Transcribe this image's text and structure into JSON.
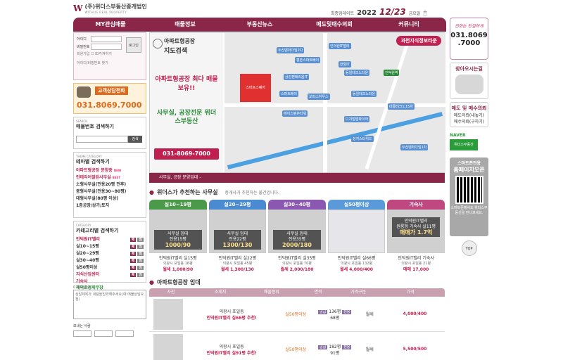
{
  "header": {
    "logo_mark": "W",
    "logo_name": "(주)위더스부동산중개법인",
    "logo_sub": "WITHUS REAL PROPERTY",
    "update_label": "최종업데이트",
    "update_year": "2022",
    "update_date": "12/23",
    "update_day": "금요일"
  },
  "nav": [
    {
      "label": "MY관심매물"
    },
    {
      "label": "매물정보"
    },
    {
      "label": "부동산뉴스"
    },
    {
      "label": "매도및매수의뢰"
    },
    {
      "label": "커뮤니티"
    }
  ],
  "login": {
    "id_label": "아이디",
    "pw_label": "비밀번호",
    "button": "로그인",
    "signup": "회원가입",
    "save_id": "ID가져하기",
    "find": "아이디/비밀번호 찾기"
  },
  "call": {
    "badge": "고객상담전화",
    "number": "031.8069.7000"
  },
  "search": {
    "hd": "SEARCH",
    "title": "매물번호 검색하기",
    "button": "검색"
  },
  "theme": {
    "hd": "THEME CATEGORY",
    "title": "테마별 검색하기",
    "items": [
      {
        "label": "아파트형공장 분양중",
        "hl": true,
        "new": "NEW"
      },
      {
        "label": "인테리어잘된사무실",
        "hl": true,
        "new": "BEST"
      },
      {
        "label": "소형사무실(전용20평 전후)",
        "hl": false,
        "new": ""
      },
      {
        "label": "중형사무실(전용30~80평)",
        "hl": false,
        "new": ""
      },
      {
        "label": "대형사무실(80평 이상)",
        "hl": false,
        "new": ""
      },
      {
        "label": "1층공장/상가/토지",
        "hl": false,
        "new": ""
      }
    ]
  },
  "category": {
    "hd": "CATEGORY",
    "title": "카테고리별 검색하기",
    "items": [
      {
        "label": "인덕원IT밸리",
        "cls": "red",
        "b1": "매",
        "b2": "임"
      },
      {
        "label": "실10~15평",
        "cls": "",
        "b1": "매",
        "b2": "임"
      },
      {
        "label": "실20~29평",
        "cls": "",
        "b1": "매",
        "b2": "임"
      },
      {
        "label": "실30~40평",
        "cls": "",
        "b1": "매",
        "b2": "임"
      },
      {
        "label": "실50평이상",
        "cls": "",
        "b1": "매",
        "b2": "임"
      },
      {
        "label": "지식산업센터",
        "cls": "red",
        "b1": "매",
        "b2": "임"
      },
      {
        "label": "기숙사",
        "cls": "red",
        "b1": "",
        "b2": ""
      },
      {
        "label": "해외조경제무장",
        "cls": "grn",
        "b1": "",
        "b2": ""
      }
    ]
  },
  "memo": {
    "count": "0 /80byte",
    "placeholder": "상담제목과 내용을입력해주세요(예:매물상담요청)",
    "sender": "보내는 사람"
  },
  "banner": {
    "t1": "아파트형공장",
    "t2": "지도검색",
    "t3": "아파트형공장 최다 매물 보유!!",
    "t4": "사무실, 공장전문 위더스부동산",
    "t5": "031-8069-7000",
    "map_title": "과천지식정보타운",
    "red_label": "스마트스퀘어",
    "buildings": [
      "두산벤처다임2차",
      "평촌스마트베이",
      "금강펜테리움IT",
      "인덕원IT밸리",
      "안양IT",
      "동일테크노타운",
      "스마트베이",
      "오피스하우스",
      "인덕원역",
      "디지털엠파이어",
      "에이스평촌타워",
      "대룡테크노15차",
      "성지스타위드",
      "두산벤처다임1차",
      "동일테크노타운"
    ]
  },
  "ticker": "사무실, 공장 분양임대 -",
  "recommend": {
    "title": "위더스가 추천하는 사무실",
    "sub": "중개사가 추천하는 물건입니다.",
    "cards": [
      {
        "tab": "실10~19평",
        "color": "#4a9a4a",
        "ov1": "사무실 임대",
        "ov2": "전용15평",
        "ov3": "1000/90",
        "name": "인덕원IT밸리 실15평",
        "addr": "의왕시 포일동 18평",
        "price": "월세 1,000/90"
      },
      {
        "tab": "실20~29평",
        "color": "#4a8ad0",
        "ov1": "사무실 임대",
        "ov2": "전용22평",
        "ov3": "1300/130",
        "name": "인덕원IT밸리 실22평",
        "addr": "의왕시 포일동 45평",
        "price": "월세 1,300/130"
      },
      {
        "tab": "실30~40평",
        "color": "#8a58b0",
        "ov1": "사무실 임대",
        "ov2": "전용35평",
        "ov3": "2000/180",
        "name": "인덕원IT밸리 실35평",
        "addr": "의왕시 포일동 70평",
        "price": "월세 2,000/180"
      },
      {
        "tab": "실50평이상",
        "color": "#5a9ad8",
        "ov1": "",
        "ov2": "",
        "ov3": "",
        "name": "인덕원IT밸리 실66평",
        "addr": "의왕시 포일동 132평",
        "price": "월세 4,000/400"
      },
      {
        "tab": "기숙사",
        "color": "#c04880",
        "ov1": "인덕원IT밸리",
        "ov2": "원룸형 기숙사 실11평",
        "ov3": "매매가 1.7억",
        "name": "인덕원IT밸리 기숙사",
        "addr": "의왕시 포일동 21평",
        "price": "매매 17,000"
      }
    ]
  },
  "list": {
    "title": "아파트형공장 임대",
    "headers": [
      "사진",
      "소재지",
      "매물종류",
      "면적",
      "가격구분",
      "가격"
    ],
    "rows": [
      {
        "loc": "의왕시 포일동",
        "hot": "인덕원IT밸리 실66평 추천!",
        "type": "실50평이상",
        "a1": "136평",
        "a2": "68평",
        "kind": "월세",
        "price": "4,000/400"
      },
      {
        "loc": "의왕시 포일동",
        "hot": "인덕원IT밸리 실91평 추천!",
        "type": "실50평이상",
        "a1": "182평",
        "a2": "91평",
        "kind": "월세",
        "price": "5,500/500"
      }
    ]
  },
  "right": {
    "phone_title": "전화는 친절하게",
    "phone_n1": "031.8069",
    "phone_n2": ".7000",
    "map_title": "찾아오시는길",
    "sale_title": "매도 및 매수의뢰",
    "sale_sub1": "매도의뢰(내놓기)",
    "sale_sub2": "매수의뢰(구하기)",
    "naver": "NAVER",
    "naver_btn": "위더스부동산",
    "mobile_h1": "스마트폰전용",
    "mobile_h2": "홈페이지오픈",
    "mobile_ft": "스마트폰에서도 위더스부동산을 만나보세요.",
    "top": "TOP"
  }
}
